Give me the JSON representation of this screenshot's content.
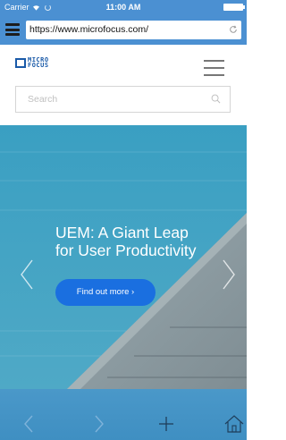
{
  "status_bar": {
    "carrier": "Carrier",
    "time": "11:00 AM"
  },
  "browser": {
    "url": "https://www.microfocus.com/"
  },
  "site": {
    "logo_line1": "MICRO",
    "logo_line2": "FOCUS",
    "search_placeholder": "Search"
  },
  "hero": {
    "title_line1": "UEM: A Giant Leap",
    "title_line2": "for User Productivity",
    "cta_label": "Find out more ›"
  },
  "icons": {
    "menu": "menu-icon",
    "reload": "reload-icon",
    "hamburger": "hamburger-icon",
    "search": "search-icon",
    "prev": "chevron-left-icon",
    "next": "chevron-right-icon",
    "back": "back-icon",
    "forward": "forward-icon",
    "add": "plus-icon",
    "home": "home-icon"
  },
  "colors": {
    "toolbar": "#4b90d2",
    "brand": "#1a5aa8",
    "cta": "#1a6fe0",
    "hero": "#49a8c6"
  }
}
